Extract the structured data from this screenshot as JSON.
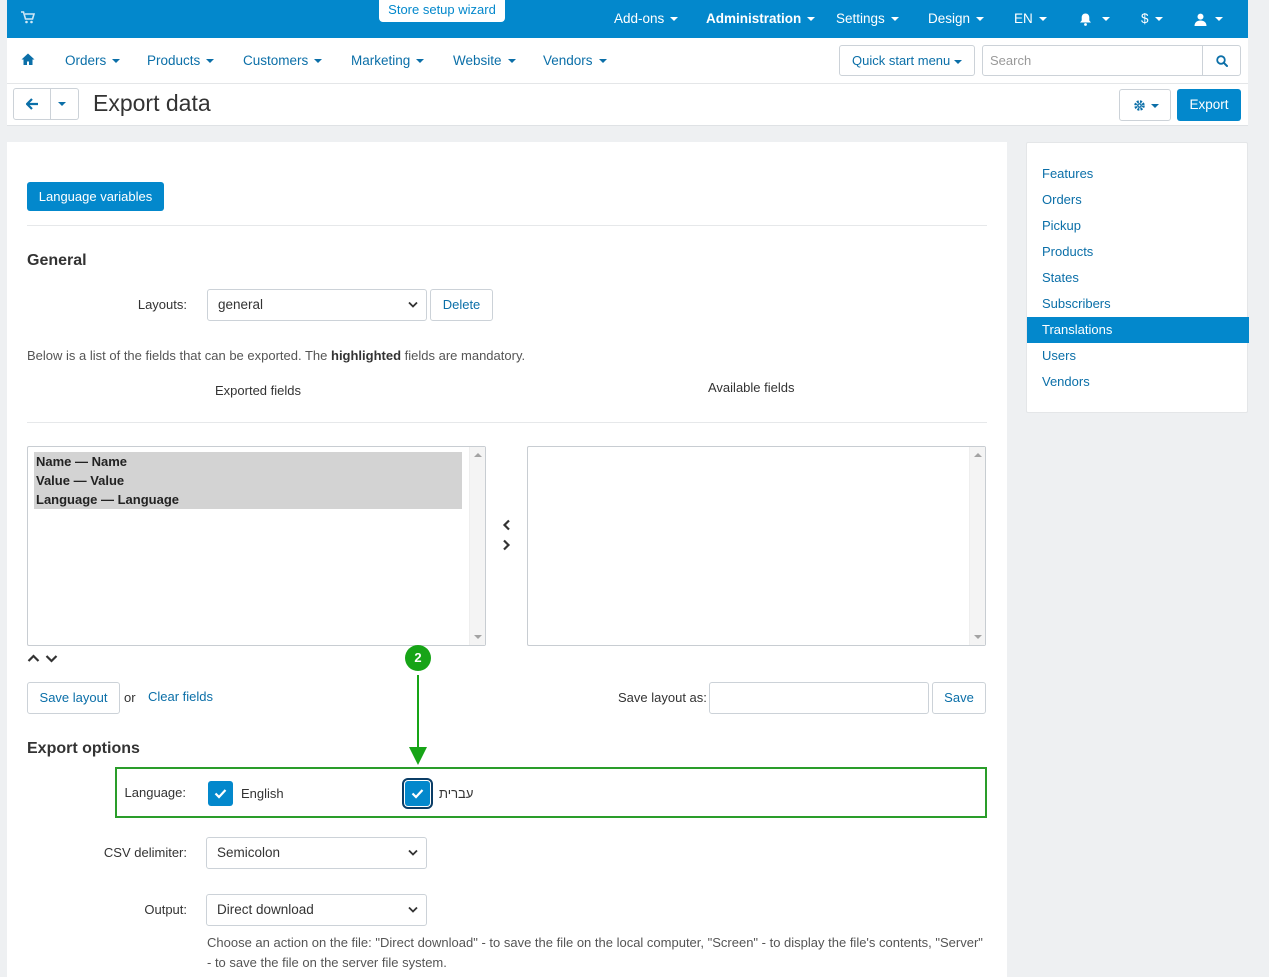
{
  "topbar": {
    "wizard_label": "Store setup wizard",
    "menus": [
      "Add-ons",
      "Administration",
      "Settings",
      "Design",
      "EN",
      "$"
    ]
  },
  "nav": {
    "items": [
      "Orders",
      "Products",
      "Customers",
      "Marketing",
      "Website",
      "Vendors"
    ],
    "quick_start_label": "Quick start menu",
    "search_placeholder": "Search"
  },
  "title": {
    "text": "Export data",
    "export_label": "Export"
  },
  "main": {
    "tab_button": "Language variables",
    "general_title": "General",
    "layouts_label": "Layouts:",
    "layouts_value": "general",
    "delete_label": "Delete",
    "info_prefix": "Below is a list of the fields that can be exported. The ",
    "info_bold": "highlighted",
    "info_suffix": " fields are mandatory.",
    "exported_fields_header": "Exported fields",
    "available_fields_header": "Available fields",
    "exported_fields": [
      "Name — Name",
      "Value — Value",
      "Language — Language"
    ],
    "available_fields": [],
    "save_layout_label": "Save layout",
    "or_text": "or",
    "clear_fields_label": "Clear fields",
    "save_layout_as_label": "Save layout as:",
    "save_label": "Save",
    "export_options_title": "Export options",
    "language_label": "Language:",
    "languages": [
      {
        "name": "English",
        "checked": true
      },
      {
        "name": "עברית",
        "checked": true
      }
    ],
    "csv_delimiter_label": "CSV delimiter:",
    "csv_delimiter_value": "Semicolon",
    "output_label": "Output:",
    "output_value": "Direct download",
    "output_help": "Choose an action on the file: \"Direct download\" - to save the file on the local computer, \"Screen\" - to display the file's contents, \"Server\" - to save the file on the server file system."
  },
  "sidebar": {
    "items": [
      "Features",
      "Orders",
      "Pickup",
      "Products",
      "States",
      "Subscribers",
      "Translations",
      "Users",
      "Vendors"
    ],
    "active": "Translations"
  },
  "annotation": {
    "step_number": "2",
    "color": "#17a417"
  },
  "colors": {
    "primary": "#0388cc",
    "link": "#0b6fa8"
  }
}
